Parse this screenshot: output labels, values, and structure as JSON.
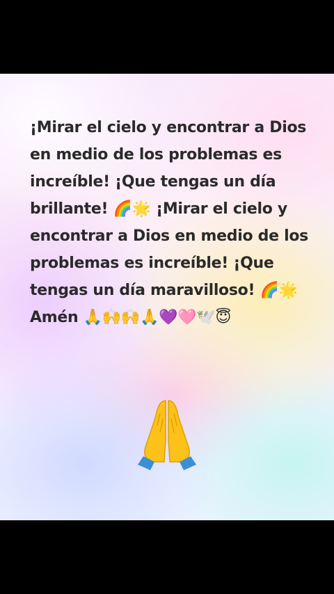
{
  "post": {
    "message": "¡Mirar el cielo y encontrar a Dios en medio de los problemas es increíble! ¡Que tengas un día brillante! 🌈🌟 ¡Mirar el cielo y encontrar a Dios en medio de los problemas es increíble! ¡Que tengas un día maravilloso! 🌈🌟 Amén 🙏🙌🙌🙏💜🩷🕊️😇",
    "large_emoji": "folded-hands-icon"
  },
  "colors": {
    "background_outer": "#000000",
    "text": "#2a2a2a",
    "hands_yellow": "#fcc21b",
    "cuff_blue": "#3a8fd6"
  }
}
